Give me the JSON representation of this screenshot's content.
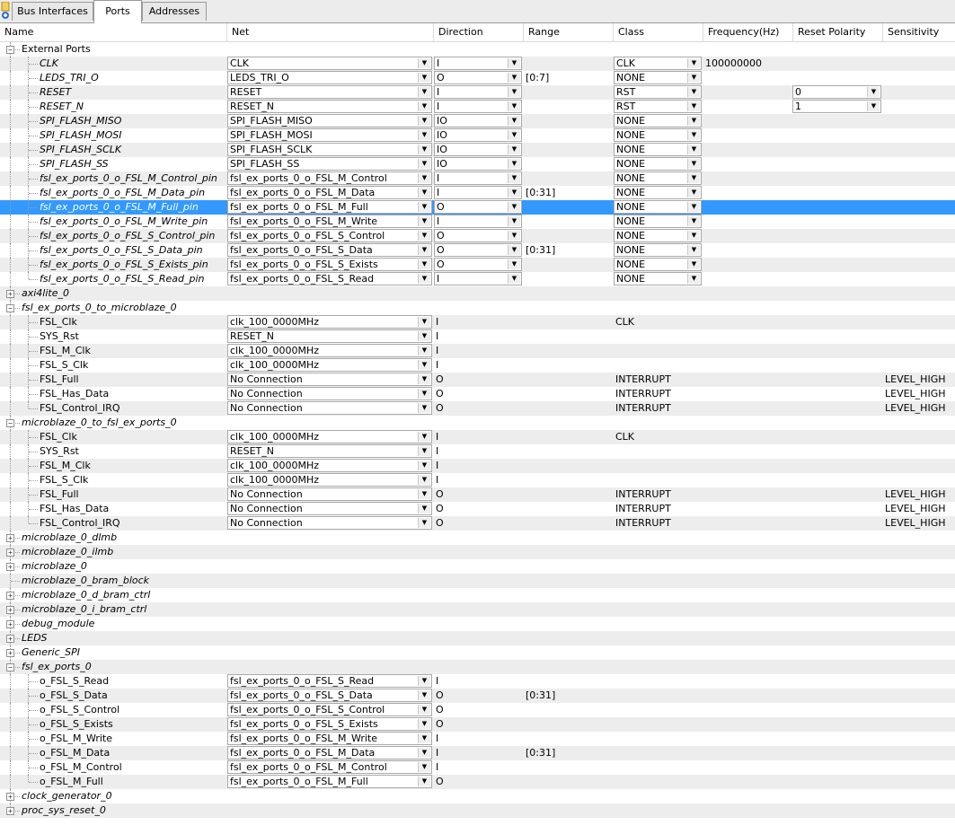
{
  "tabs": [
    {
      "label": "Bus Interfaces",
      "active": false
    },
    {
      "label": "Ports",
      "active": true
    },
    {
      "label": "Addresses",
      "active": false
    }
  ],
  "columns": [
    "Name",
    "Net",
    "Direction",
    "Range",
    "Class",
    "Frequency(Hz)",
    "Reset Polarity",
    "Sensitivity"
  ],
  "rows": [
    {
      "type": "group",
      "name": "External Ports",
      "expanded": true,
      "italic": false
    },
    {
      "type": "port",
      "name": "CLK",
      "italic": true,
      "net": "CLK",
      "net_combo": true,
      "dir": "I",
      "dir_combo": true,
      "range": "",
      "cls": "CLK",
      "cls_combo": true,
      "freq": "100000000",
      "resetpol": "",
      "sens": ""
    },
    {
      "type": "port",
      "name": "LEDS_TRI_O",
      "italic": true,
      "net": "LEDS_TRI_O",
      "net_combo": true,
      "dir": "O",
      "dir_combo": true,
      "range": "[0:7]",
      "cls": "NONE",
      "cls_combo": true,
      "freq": "",
      "resetpol": "",
      "sens": ""
    },
    {
      "type": "port",
      "name": "RESET",
      "italic": true,
      "net": "RESET",
      "net_combo": true,
      "dir": "I",
      "dir_combo": true,
      "range": "",
      "cls": "RST",
      "cls_combo": true,
      "freq": "",
      "resetpol": "0",
      "sens": ""
    },
    {
      "type": "port",
      "name": "RESET_N",
      "italic": true,
      "net": "RESET_N",
      "net_combo": true,
      "dir": "I",
      "dir_combo": true,
      "range": "",
      "cls": "RST",
      "cls_combo": true,
      "freq": "",
      "resetpol": "1",
      "sens": ""
    },
    {
      "type": "port",
      "name": "SPI_FLASH_MISO",
      "italic": true,
      "net": "SPI_FLASH_MISO",
      "net_combo": true,
      "dir": "IO",
      "dir_combo": true,
      "range": "",
      "cls": "NONE",
      "cls_combo": true,
      "freq": "",
      "resetpol": "",
      "sens": ""
    },
    {
      "type": "port",
      "name": "SPI_FLASH_MOSI",
      "italic": true,
      "net": "SPI_FLASH_MOSI",
      "net_combo": true,
      "dir": "IO",
      "dir_combo": true,
      "range": "",
      "cls": "NONE",
      "cls_combo": true,
      "freq": "",
      "resetpol": "",
      "sens": ""
    },
    {
      "type": "port",
      "name": "SPI_FLASH_SCLK",
      "italic": true,
      "net": "SPI_FLASH_SCLK",
      "net_combo": true,
      "dir": "IO",
      "dir_combo": true,
      "range": "",
      "cls": "NONE",
      "cls_combo": true,
      "freq": "",
      "resetpol": "",
      "sens": ""
    },
    {
      "type": "port",
      "name": "SPI_FLASH_SS",
      "italic": true,
      "net": "SPI_FLASH_SS",
      "net_combo": true,
      "dir": "IO",
      "dir_combo": true,
      "range": "",
      "cls": "NONE",
      "cls_combo": true,
      "freq": "",
      "resetpol": "",
      "sens": ""
    },
    {
      "type": "port",
      "name": "fsl_ex_ports_0_o_FSL_M_Control_pin",
      "italic": true,
      "net": "fsl_ex_ports_0_o_FSL_M_Control",
      "net_combo": true,
      "dir": "I",
      "dir_combo": true,
      "range": "",
      "cls": "NONE",
      "cls_combo": true,
      "freq": "",
      "resetpol": "",
      "sens": ""
    },
    {
      "type": "port",
      "name": "fsl_ex_ports_0_o_FSL_M_Data_pin",
      "italic": true,
      "net": "fsl_ex_ports_0_o_FSL_M_Data",
      "net_combo": true,
      "dir": "I",
      "dir_combo": true,
      "range": "[0:31]",
      "cls": "NONE",
      "cls_combo": true,
      "freq": "",
      "resetpol": "",
      "sens": ""
    },
    {
      "type": "port",
      "name": "fsl_ex_ports_0_o_FSL_M_Full_pin",
      "italic": true,
      "net": "fsl_ex_ports_0_o_FSL_M_Full",
      "net_combo": true,
      "dir": "O",
      "dir_combo": true,
      "range": "",
      "cls": "NONE",
      "cls_combo": true,
      "freq": "",
      "resetpol": "",
      "sens": "",
      "selected": true
    },
    {
      "type": "port",
      "name": "fsl_ex_ports_0_o_FSL_M_Write_pin",
      "italic": true,
      "net": "fsl_ex_ports_0_o_FSL_M_Write",
      "net_combo": true,
      "dir": "I",
      "dir_combo": true,
      "range": "",
      "cls": "NONE",
      "cls_combo": true,
      "freq": "",
      "resetpol": "",
      "sens": ""
    },
    {
      "type": "port",
      "name": "fsl_ex_ports_0_o_FSL_S_Control_pin",
      "italic": true,
      "net": "fsl_ex_ports_0_o_FSL_S_Control",
      "net_combo": true,
      "dir": "O",
      "dir_combo": true,
      "range": "",
      "cls": "NONE",
      "cls_combo": true,
      "freq": "",
      "resetpol": "",
      "sens": ""
    },
    {
      "type": "port",
      "name": "fsl_ex_ports_0_o_FSL_S_Data_pin",
      "italic": true,
      "net": "fsl_ex_ports_0_o_FSL_S_Data",
      "net_combo": true,
      "dir": "O",
      "dir_combo": true,
      "range": "[0:31]",
      "cls": "NONE",
      "cls_combo": true,
      "freq": "",
      "resetpol": "",
      "sens": ""
    },
    {
      "type": "port",
      "name": "fsl_ex_ports_0_o_FSL_S_Exists_pin",
      "italic": true,
      "net": "fsl_ex_ports_0_o_FSL_S_Exists",
      "net_combo": true,
      "dir": "O",
      "dir_combo": true,
      "range": "",
      "cls": "NONE",
      "cls_combo": true,
      "freq": "",
      "resetpol": "",
      "sens": ""
    },
    {
      "type": "port",
      "name": "fsl_ex_ports_0_o_FSL_S_Read_pin",
      "italic": true,
      "net": "fsl_ex_ports_0_o_FSL_S_Read",
      "net_combo": true,
      "dir": "I",
      "dir_combo": true,
      "range": "",
      "cls": "NONE",
      "cls_combo": true,
      "freq": "",
      "resetpol": "",
      "sens": "",
      "last": true
    },
    {
      "type": "group",
      "name": "axi4lite_0",
      "expanded": false,
      "italic": true
    },
    {
      "type": "group",
      "name": "fsl_ex_ports_0_to_microblaze_0",
      "expanded": true,
      "italic": true
    },
    {
      "type": "port",
      "name": "FSL_Clk",
      "italic": false,
      "net": "clk_100_0000MHz",
      "net_combo": true,
      "dir": "I",
      "dir_combo": false,
      "range": "",
      "cls": "CLK",
      "cls_combo": false,
      "freq": "",
      "resetpol": "",
      "sens": ""
    },
    {
      "type": "port",
      "name": "SYS_Rst",
      "italic": false,
      "net": "RESET_N",
      "net_combo": true,
      "dir": "I",
      "dir_combo": false,
      "range": "",
      "cls": "",
      "cls_combo": false,
      "freq": "",
      "resetpol": "",
      "sens": ""
    },
    {
      "type": "port",
      "name": "FSL_M_Clk",
      "italic": false,
      "net": "clk_100_0000MHz",
      "net_combo": true,
      "dir": "I",
      "dir_combo": false,
      "range": "",
      "cls": "",
      "cls_combo": false,
      "freq": "",
      "resetpol": "",
      "sens": ""
    },
    {
      "type": "port",
      "name": "FSL_S_Clk",
      "italic": false,
      "net": "clk_100_0000MHz",
      "net_combo": true,
      "dir": "I",
      "dir_combo": false,
      "range": "",
      "cls": "",
      "cls_combo": false,
      "freq": "",
      "resetpol": "",
      "sens": ""
    },
    {
      "type": "port",
      "name": "FSL_Full",
      "italic": false,
      "net": "No Connection",
      "net_combo": true,
      "dir": "O",
      "dir_combo": false,
      "range": "",
      "cls": "INTERRUPT",
      "cls_combo": false,
      "freq": "",
      "resetpol": "",
      "sens": "LEVEL_HIGH"
    },
    {
      "type": "port",
      "name": "FSL_Has_Data",
      "italic": false,
      "net": "No Connection",
      "net_combo": true,
      "dir": "O",
      "dir_combo": false,
      "range": "",
      "cls": "INTERRUPT",
      "cls_combo": false,
      "freq": "",
      "resetpol": "",
      "sens": "LEVEL_HIGH"
    },
    {
      "type": "port",
      "name": "FSL_Control_IRQ",
      "italic": false,
      "net": "No Connection",
      "net_combo": true,
      "dir": "O",
      "dir_combo": false,
      "range": "",
      "cls": "INTERRUPT",
      "cls_combo": false,
      "freq": "",
      "resetpol": "",
      "sens": "LEVEL_HIGH",
      "last": true
    },
    {
      "type": "group",
      "name": "microblaze_0_to_fsl_ex_ports_0",
      "expanded": true,
      "italic": true
    },
    {
      "type": "port",
      "name": "FSL_Clk",
      "italic": false,
      "net": "clk_100_0000MHz",
      "net_combo": true,
      "dir": "I",
      "dir_combo": false,
      "range": "",
      "cls": "CLK",
      "cls_combo": false,
      "freq": "",
      "resetpol": "",
      "sens": ""
    },
    {
      "type": "port",
      "name": "SYS_Rst",
      "italic": false,
      "net": "RESET_N",
      "net_combo": true,
      "dir": "I",
      "dir_combo": false,
      "range": "",
      "cls": "",
      "cls_combo": false,
      "freq": "",
      "resetpol": "",
      "sens": ""
    },
    {
      "type": "port",
      "name": "FSL_M_Clk",
      "italic": false,
      "net": "clk_100_0000MHz",
      "net_combo": true,
      "dir": "I",
      "dir_combo": false,
      "range": "",
      "cls": "",
      "cls_combo": false,
      "freq": "",
      "resetpol": "",
      "sens": ""
    },
    {
      "type": "port",
      "name": "FSL_S_Clk",
      "italic": false,
      "net": "clk_100_0000MHz",
      "net_combo": true,
      "dir": "I",
      "dir_combo": false,
      "range": "",
      "cls": "",
      "cls_combo": false,
      "freq": "",
      "resetpol": "",
      "sens": ""
    },
    {
      "type": "port",
      "name": "FSL_Full",
      "italic": false,
      "net": "No Connection",
      "net_combo": true,
      "dir": "O",
      "dir_combo": false,
      "range": "",
      "cls": "INTERRUPT",
      "cls_combo": false,
      "freq": "",
      "resetpol": "",
      "sens": "LEVEL_HIGH"
    },
    {
      "type": "port",
      "name": "FSL_Has_Data",
      "italic": false,
      "net": "No Connection",
      "net_combo": true,
      "dir": "O",
      "dir_combo": false,
      "range": "",
      "cls": "INTERRUPT",
      "cls_combo": false,
      "freq": "",
      "resetpol": "",
      "sens": "LEVEL_HIGH"
    },
    {
      "type": "port",
      "name": "FSL_Control_IRQ",
      "italic": false,
      "net": "No Connection",
      "net_combo": true,
      "dir": "O",
      "dir_combo": false,
      "range": "",
      "cls": "INTERRUPT",
      "cls_combo": false,
      "freq": "",
      "resetpol": "",
      "sens": "LEVEL_HIGH",
      "last": true
    },
    {
      "type": "group",
      "name": "microblaze_0_dlmb",
      "expanded": false,
      "italic": true
    },
    {
      "type": "group",
      "name": "microblaze_0_ilmb",
      "expanded": false,
      "italic": true
    },
    {
      "type": "group",
      "name": "microblaze_0",
      "expanded": false,
      "italic": true
    },
    {
      "type": "group",
      "name": "microblaze_0_bram_block",
      "expanded": null,
      "italic": true
    },
    {
      "type": "group",
      "name": "microblaze_0_d_bram_ctrl",
      "expanded": false,
      "italic": true
    },
    {
      "type": "group",
      "name": "microblaze_0_i_bram_ctrl",
      "expanded": false,
      "italic": true
    },
    {
      "type": "group",
      "name": "debug_module",
      "expanded": false,
      "italic": true
    },
    {
      "type": "group",
      "name": "LEDS",
      "expanded": false,
      "italic": true
    },
    {
      "type": "group",
      "name": "Generic_SPI",
      "expanded": false,
      "italic": true
    },
    {
      "type": "group",
      "name": "fsl_ex_ports_0",
      "expanded": true,
      "italic": true
    },
    {
      "type": "port",
      "name": "o_FSL_S_Read",
      "italic": false,
      "net": "fsl_ex_ports_0_o_FSL_S_Read",
      "net_combo": true,
      "dir": "I",
      "dir_combo": false,
      "range": "",
      "cls": "",
      "cls_combo": false,
      "freq": "",
      "resetpol": "",
      "sens": ""
    },
    {
      "type": "port",
      "name": "o_FSL_S_Data",
      "italic": false,
      "net": "fsl_ex_ports_0_o_FSL_S_Data",
      "net_combo": true,
      "dir": "O",
      "dir_combo": false,
      "range": "[0:31]",
      "cls": "",
      "cls_combo": false,
      "freq": "",
      "resetpol": "",
      "sens": ""
    },
    {
      "type": "port",
      "name": "o_FSL_S_Control",
      "italic": false,
      "net": "fsl_ex_ports_0_o_FSL_S_Control",
      "net_combo": true,
      "dir": "O",
      "dir_combo": false,
      "range": "",
      "cls": "",
      "cls_combo": false,
      "freq": "",
      "resetpol": "",
      "sens": ""
    },
    {
      "type": "port",
      "name": "o_FSL_S_Exists",
      "italic": false,
      "net": "fsl_ex_ports_0_o_FSL_S_Exists",
      "net_combo": true,
      "dir": "O",
      "dir_combo": false,
      "range": "",
      "cls": "",
      "cls_combo": false,
      "freq": "",
      "resetpol": "",
      "sens": ""
    },
    {
      "type": "port",
      "name": "o_FSL_M_Write",
      "italic": false,
      "net": "fsl_ex_ports_0_o_FSL_M_Write",
      "net_combo": true,
      "dir": "I",
      "dir_combo": false,
      "range": "",
      "cls": "",
      "cls_combo": false,
      "freq": "",
      "resetpol": "",
      "sens": ""
    },
    {
      "type": "port",
      "name": "o_FSL_M_Data",
      "italic": false,
      "net": "fsl_ex_ports_0_o_FSL_M_Data",
      "net_combo": true,
      "dir": "I",
      "dir_combo": false,
      "range": "[0:31]",
      "cls": "",
      "cls_combo": false,
      "freq": "",
      "resetpol": "",
      "sens": ""
    },
    {
      "type": "port",
      "name": "o_FSL_M_Control",
      "italic": false,
      "net": "fsl_ex_ports_0_o_FSL_M_Control",
      "net_combo": true,
      "dir": "I",
      "dir_combo": false,
      "range": "",
      "cls": "",
      "cls_combo": false,
      "freq": "",
      "resetpol": "",
      "sens": ""
    },
    {
      "type": "port",
      "name": "o_FSL_M_Full",
      "italic": false,
      "net": "fsl_ex_ports_0_o_FSL_M_Full",
      "net_combo": true,
      "dir": "O",
      "dir_combo": false,
      "range": "",
      "cls": "",
      "cls_combo": false,
      "freq": "",
      "resetpol": "",
      "sens": "",
      "last": true
    },
    {
      "type": "group",
      "name": "clock_generator_0",
      "expanded": false,
      "italic": true
    },
    {
      "type": "group",
      "name": "proc_sys_reset_0",
      "expanded": false,
      "italic": true
    }
  ],
  "colors": {
    "selection": "#3399ff",
    "alt_row": "#ededed",
    "grid": "#dcdcdc"
  }
}
